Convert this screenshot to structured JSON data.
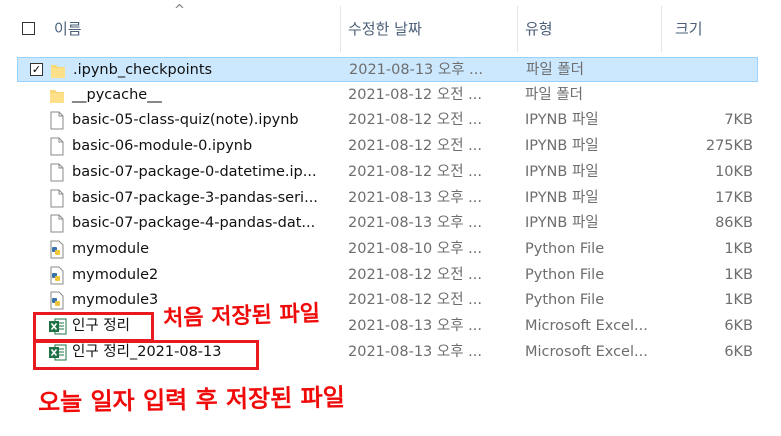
{
  "header": {
    "name_label": "이름",
    "date_label": "수정한 날짜",
    "type_label": "유형",
    "size_label": "크기",
    "sort_indicator": "^"
  },
  "files": [
    {
      "name": ".ipynb_checkpoints",
      "date": "2021-08-13 오후 ...",
      "type": "파일 폴더",
      "size": "",
      "icon": "folder-icon",
      "selected": true,
      "checked": true
    },
    {
      "name": "__pycache__",
      "date": "2021-08-12 오전 ...",
      "type": "파일 폴더",
      "size": "",
      "icon": "folder-icon"
    },
    {
      "name": "basic-05-class-quiz(note).ipynb",
      "date": "2021-08-12 오전 ...",
      "type": "IPYNB 파일",
      "size": "7KB",
      "icon": "document-icon"
    },
    {
      "name": "basic-06-module-0.ipynb",
      "date": "2021-08-12 오전 ...",
      "type": "IPYNB 파일",
      "size": "275KB",
      "icon": "document-icon"
    },
    {
      "name": "basic-07-package-0-datetime.ip...",
      "date": "2021-08-12 오전 ...",
      "type": "IPYNB 파일",
      "size": "10KB",
      "icon": "document-icon"
    },
    {
      "name": "basic-07-package-3-pandas-seri...",
      "date": "2021-08-13 오후 ...",
      "type": "IPYNB 파일",
      "size": "17KB",
      "icon": "document-icon"
    },
    {
      "name": "basic-07-package-4-pandas-dat...",
      "date": "2021-08-13 오후 ...",
      "type": "IPYNB 파일",
      "size": "86KB",
      "icon": "document-icon"
    },
    {
      "name": "mymodule",
      "date": "2021-08-10 오후 ...",
      "type": "Python File",
      "size": "1KB",
      "icon": "python-file-icon"
    },
    {
      "name": "mymodule2",
      "date": "2021-08-12 오전 ...",
      "type": "Python File",
      "size": "1KB",
      "icon": "python-file-icon"
    },
    {
      "name": "mymodule3",
      "date": "2021-08-12 오전 ...",
      "type": "Python File",
      "size": "1KB",
      "icon": "python-file-icon"
    },
    {
      "name": "인구 정리",
      "date": "2021-08-13 오후 ...",
      "type": "Microsoft Excel...",
      "size": "6KB",
      "icon": "excel-file-icon"
    },
    {
      "name": "인구 정리_2021-08-13",
      "date": "2021-08-13 오후 ...",
      "type": "Microsoft Excel...",
      "size": "6KB",
      "icon": "excel-file-icon"
    }
  ],
  "annotations": {
    "first_saved": "처음 저장된 파일",
    "today_saved": "오늘 일자 입력 후 저장된 파일"
  },
  "colors": {
    "selection": "#cce8ff",
    "annotation": "#f00b0b",
    "header_text": "#4c607a"
  }
}
